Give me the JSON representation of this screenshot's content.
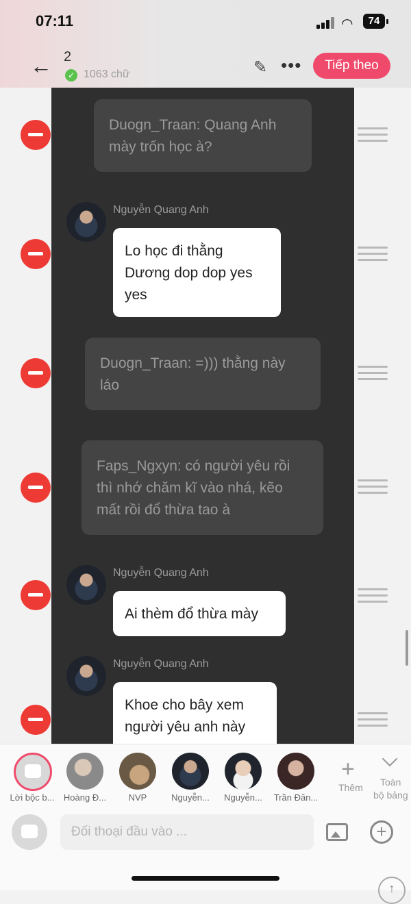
{
  "status_bar": {
    "time": "07:11",
    "battery": "74"
  },
  "header": {
    "chapter_number": "2",
    "word_count": "1063 chữ",
    "next_label": "Tiếp theo",
    "back_icon": "back-arrow-icon",
    "edit_icon": "pencil-icon",
    "more_icon": "more-icon"
  },
  "messages": [
    {
      "type": "narration",
      "text": "Duogn_Traan: Quang Anh mày trốn học à?"
    },
    {
      "type": "dialogue",
      "speaker": "Nguyễn Quang Anh",
      "text": "Lo học đi thằng Dương dop dop yes yes"
    },
    {
      "type": "narration",
      "text": "Duogn_Traan: =))) thằng này láo"
    },
    {
      "type": "narration",
      "text": "Faps_Ngxyn: có người yêu rồi thì nhớ chăm kĩ vào nhá, kẽo mất rồi đổ thừa tao à"
    },
    {
      "type": "dialogue",
      "speaker": "Nguyễn Quang Anh",
      "text": "Ai thèm đổ thừa mày"
    },
    {
      "type": "dialogue",
      "speaker": "Nguyễn Quang Anh",
      "text": "Khoe cho bây xem người yêu anh này"
    }
  ],
  "characters": [
    {
      "label": "Lời bộc b..."
    },
    {
      "label": "Hoàng Đ..."
    },
    {
      "label": "NVP"
    },
    {
      "label": "Nguyễn..."
    },
    {
      "label": "Nguyễn..."
    },
    {
      "label": "Trần Đăn..."
    }
  ],
  "more_characters_label": "Thêm",
  "collapse_label_1": "Toàn",
  "collapse_label_2": "bộ bảng",
  "input": {
    "placeholder": "Đối thoại đầu vào ..."
  },
  "colors": {
    "accent": "#ef4a6b",
    "delete": "#ee3a35",
    "panel": "#2f2f2f"
  }
}
